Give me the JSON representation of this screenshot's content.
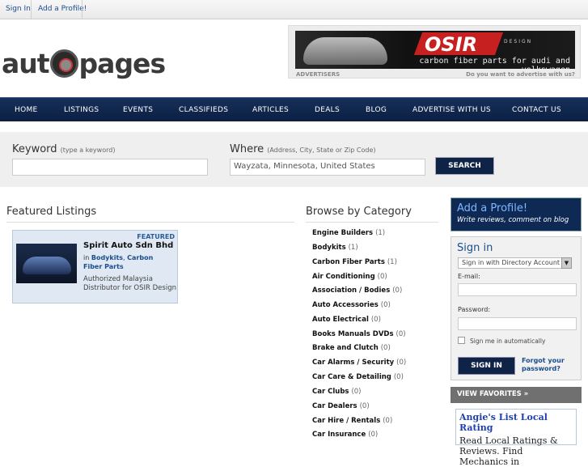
{
  "topbar": {
    "signin": "Sign In",
    "add_profile": "Add a Profile!"
  },
  "logo": {
    "left": "aut",
    "right": "pages"
  },
  "ad": {
    "brand": "OSIR",
    "design": "DESIGN",
    "tagline": "carbon fiber parts for audi and volkswagen",
    "advertisers": "ADVERTISERS",
    "ask": "Do you want to advertise with us?"
  },
  "nav": [
    "HOME",
    "LISTINGS",
    "EVENTS",
    "CLASSIFIEDS",
    "ARTICLES",
    "DEALS",
    "BLOG",
    "ADVERTISE WITH US",
    "CONTACT US"
  ],
  "search": {
    "keyword_label": "Keyword",
    "keyword_hint": "(type a keyword)",
    "where_label": "Where",
    "where_hint": "(Address, City, State or Zip Code)",
    "where_value": "Wayzata, Minnesota, United States",
    "button": "SEARCH"
  },
  "featured": {
    "heading": "Featured Listings",
    "badge": "FEATURED",
    "title": "Spirit Auto Sdn Bhd",
    "in": "in",
    "cat1": "Bodykits",
    "cat2": "Carbon Fiber Parts",
    "desc": "Authorized Malaysia Distributor for OSIR Design"
  },
  "browse": {
    "heading": "Browse by Category",
    "items": [
      {
        "name": "Engine Builders",
        "count": "(1)"
      },
      {
        "name": "Bodykits",
        "count": "(1)"
      },
      {
        "name": "Carbon Fiber Parts",
        "count": "(1)"
      },
      {
        "name": "Air Conditioning",
        "count": "(0)"
      },
      {
        "name": "Association / Bodies",
        "count": "(0)"
      },
      {
        "name": "Auto Accessories",
        "count": "(0)"
      },
      {
        "name": "Auto Electrical",
        "count": "(0)"
      },
      {
        "name": "Books Manuals DVDs",
        "count": "(0)"
      },
      {
        "name": "Brake and Clutch",
        "count": "(0)"
      },
      {
        "name": "Car Alarms / Security",
        "count": "(0)"
      },
      {
        "name": "Car Care & Detailing",
        "count": "(0)"
      },
      {
        "name": "Car Clubs",
        "count": "(0)"
      },
      {
        "name": "Car Dealers",
        "count": "(0)"
      },
      {
        "name": "Car Hire / Rentals",
        "count": "(0)"
      },
      {
        "name": "Car Insurance",
        "count": "(0)"
      }
    ]
  },
  "sidebar": {
    "add_title": "Add a Profile!",
    "add_sub": "Write reviews, comment on blog",
    "signin_title": "Sign in",
    "select": "Sign in with Directory Account",
    "email": "E-mail:",
    "password": "Password:",
    "remember": "Sign me in automatically",
    "signin_btn": "SIGN IN",
    "forgot": "Forgot your password?",
    "favorites": "VIEW FAVORITES »",
    "angie_title": "Angie's List Local Rating",
    "angie_sub": "Read Local Ratings & Reviews. Find Mechanics in"
  }
}
